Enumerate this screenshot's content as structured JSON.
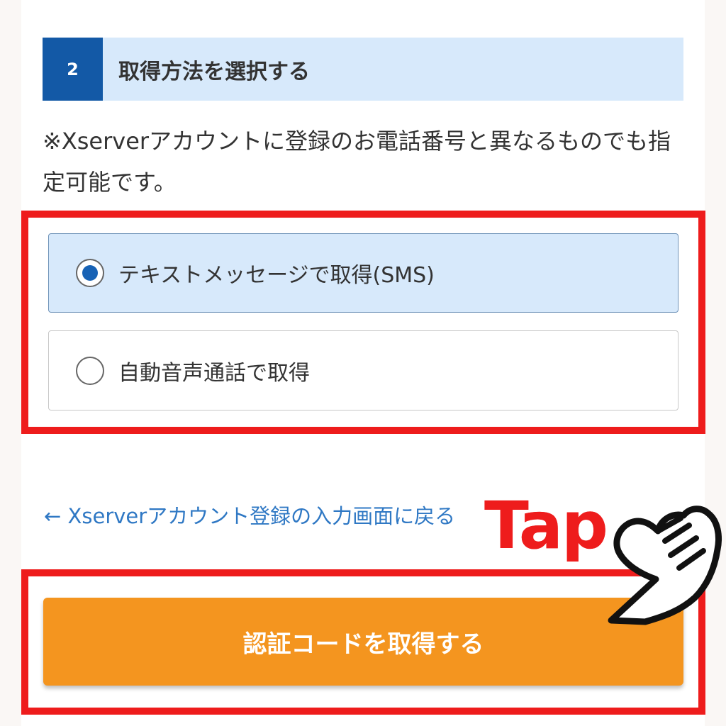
{
  "step": {
    "number": "2",
    "title": "取得方法を選択する"
  },
  "note": "※Xserverアカウントに登録のお電話番号と異なるものでも指定可能です。",
  "options": [
    {
      "label": "テキストメッセージで取得(SMS)",
      "selected": true
    },
    {
      "label": "自動音声通話で取得",
      "selected": false
    }
  ],
  "back_link": "← Xserverアカウント登録の入力画面に戻る",
  "submit_label": "認証コードを取得する",
  "annotation": {
    "tap_text": "Tap",
    "hand_icon": "pointing-hand-icon",
    "highlight_color": "#ee1c1c"
  },
  "colors": {
    "primary": "#1359a6",
    "button": "#f4951f",
    "selected_bg": "#d7e9fb"
  }
}
